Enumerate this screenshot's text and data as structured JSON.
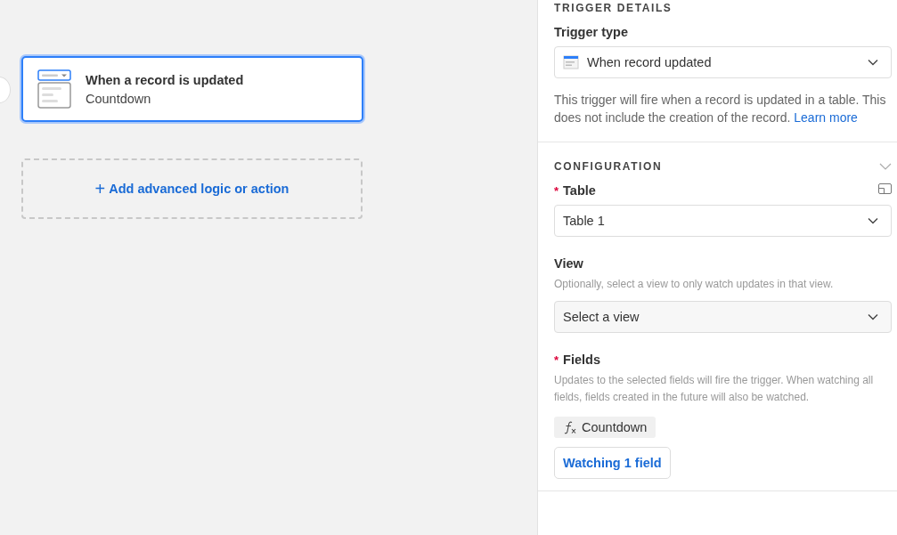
{
  "canvas": {
    "trigger_card": {
      "title": "When a record is updated",
      "subtitle": "Countdown",
      "selected": true
    },
    "add_action": {
      "icon": "+",
      "label": "Add advanced logic or action"
    }
  },
  "panel": {
    "trigger_details": {
      "heading": "TRIGGER DETAILS",
      "trigger_type_label": "Trigger type",
      "trigger_type_value": "When record updated",
      "description": "This trigger will fire when a record is updated in a table. This does not include the creation of the record.",
      "link": "Learn more"
    },
    "configuration": {
      "heading": "CONFIGURATION",
      "expanded": true,
      "table": {
        "label": "Table",
        "required_mark": "*",
        "value": "Table 1"
      },
      "view": {
        "label": "View",
        "hint": "Optionally, select a view to only watch updates in that view.",
        "placeholder": "Select a view"
      },
      "fields": {
        "label": "Fields",
        "required_mark": "*",
        "hint": "Updates to the selected fields will fire the trigger. When watching all fields, fields created in the future will also be watched.",
        "chips": [
          {
            "label": "Countdown",
            "kind": "formula"
          }
        ],
        "button": "Watching 1 field"
      }
    }
  }
}
